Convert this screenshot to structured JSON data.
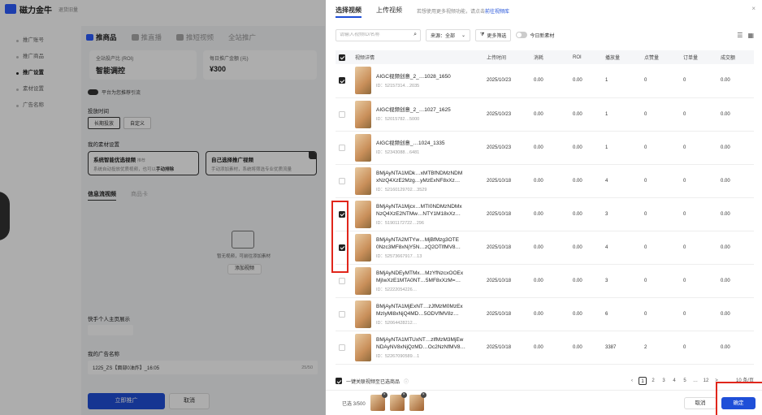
{
  "app": {
    "name": "磁力金牛",
    "subtitle": "退货旧量"
  },
  "leftnav": [
    "推广账号",
    "推广商品",
    "推广设置",
    "素材设置",
    "广告名称"
  ],
  "main": {
    "tabs": [
      "推商品",
      "推直播",
      "推短视频",
      "全站推广"
    ],
    "roi_label": "全站投产比 (ROI)",
    "roi_value": "智能调控",
    "budget_label": "每日推广金额 (元)",
    "budget_value": "¥300",
    "toggle_text": "平台为您推荐引流",
    "delivery_label": "投放时间",
    "delivery_opts": [
      "长期投放",
      "自定义"
    ],
    "material_label": "我的素材设置",
    "opt1_title": "系统智能优选视频",
    "opt1_tag": "推荐",
    "opt1_desc": "系统自动投放优质视频，也可以",
    "opt1_link": "手动排除",
    "opt2_title": "自己选择推广视频",
    "opt2_desc": "手动添加素材，系统将筛选专业优质流量",
    "sub_tabs": [
      "信息流视频",
      "商品卡"
    ],
    "empty_text": "暂无视频，可前往添加素材",
    "add_video": "添加视频",
    "personal_label": "快手个人主页展示",
    "adname_label": "我的广告名称",
    "adname_value": "1225_ZS【面部0油炸】_16:05",
    "adname_count": "25/50",
    "submit": "立即推广",
    "cancel": "取消"
  },
  "drawer": {
    "tabs": [
      "选择视频",
      "上传视频"
    ],
    "hint": "若想使用更多视频功能，请点击",
    "hint_link": "前往视频库",
    "close": "×",
    "search_placeholder": "请输入视频ID/名称",
    "source_label": "来源：全部",
    "more_filter": "更多筛选",
    "today_new": "今日新素材",
    "headers": [
      "视频详情",
      "上传时间",
      "消耗",
      "ROI",
      "播放量",
      "点赞量",
      "订单量",
      "成交额"
    ],
    "rows": [
      {
        "checked": true,
        "name": "AIGC视频创意_2_…1028_1650",
        "id": "ID：52157314…2035",
        "date": "2025/10/23",
        "cost": "0.00",
        "roi": "0.00",
        "plays": "1",
        "likes": "0",
        "orders": "0",
        "gmv": "0.00"
      },
      {
        "checked": false,
        "name": "AIGC视频创意_2_…1027_1625",
        "id": "ID：52015782…5000",
        "date": "2025/10/23",
        "cost": "0.00",
        "roi": "0.00",
        "plays": "1",
        "likes": "0",
        "orders": "0",
        "gmv": "0.00"
      },
      {
        "checked": false,
        "name": "AIGC视频创意_…1024_1335",
        "id": "ID：52343088…6481",
        "date": "2025/10/23",
        "cost": "0.00",
        "roi": "0.00",
        "plays": "1",
        "likes": "0",
        "orders": "0",
        "gmv": "0.00"
      },
      {
        "checked": false,
        "name": "BMjAyNTA1MDk…xMTBfNDMzNDM xNzQ4XzE2Mzg…yMzExNF8xXz…",
        "id": "ID：52160129702…3529",
        "date": "2025/10/18",
        "cost": "0.00",
        "roi": "0.00",
        "plays": "4",
        "likes": "0",
        "orders": "0",
        "gmv": "0.00"
      },
      {
        "checked": true,
        "name": "BMjAyNTA1Mjcx…MTI0NDMzNDMx NzQ4XzE2NTMw…NTY1M18xXz…",
        "id": "ID：51901172722…296",
        "date": "2025/10/18",
        "cost": "0.00",
        "roi": "0.00",
        "plays": "3",
        "likes": "0",
        "orders": "0",
        "gmv": "0.00"
      },
      {
        "checked": true,
        "name": "BMjAyNTA2MTYw…MjBfMzg3OTE 0Nzc3MF8xNjY5N…zQ2OTlfMV8…",
        "id": "ID：52573667917…13",
        "date": "2025/10/18",
        "cost": "0.00",
        "roi": "0.00",
        "plays": "4",
        "likes": "0",
        "orders": "0",
        "gmv": "0.00"
      },
      {
        "checked": false,
        "name": "BMjAyNDEyMTMx…MzYfNzcxOOEx MjIwXzE1MTA0NT…5MF8xXzM=…",
        "id": "ID：52222054226…",
        "date": "2025/10/18",
        "cost": "0.00",
        "roi": "0.00",
        "plays": "3",
        "likes": "0",
        "orders": "0",
        "gmv": "0.00"
      },
      {
        "checked": false,
        "name": "BMjAyNTA1MjExNT…zJfMzM0MzEx MzIyMl8xNjQ4MD…5ODVfMV8z…",
        "id": "ID：52064428212…",
        "date": "2025/10/18",
        "cost": "0.00",
        "roi": "0.00",
        "plays": "6",
        "likes": "0",
        "orders": "0",
        "gmv": "0.00"
      },
      {
        "checked": false,
        "name": "BMjAyNTA1MTUxNT…zlfMzM3MjEw NDAyNV8xNjQzMD…Oc2NzNfMV8…",
        "id": "ID：52267090589…1",
        "date": "2025/10/18",
        "cost": "0.00",
        "roi": "0.00",
        "plays": "3387",
        "likes": "2",
        "orders": "0",
        "gmv": "0.00"
      }
    ],
    "footer_check": "一键关联视频至已选商品",
    "pages": [
      "1",
      "2",
      "3",
      "4",
      "5",
      "…",
      "12",
      ">",
      "10 条/页"
    ],
    "selected_count": "已选 3/500",
    "cancel": "取消",
    "confirm": "确定"
  }
}
